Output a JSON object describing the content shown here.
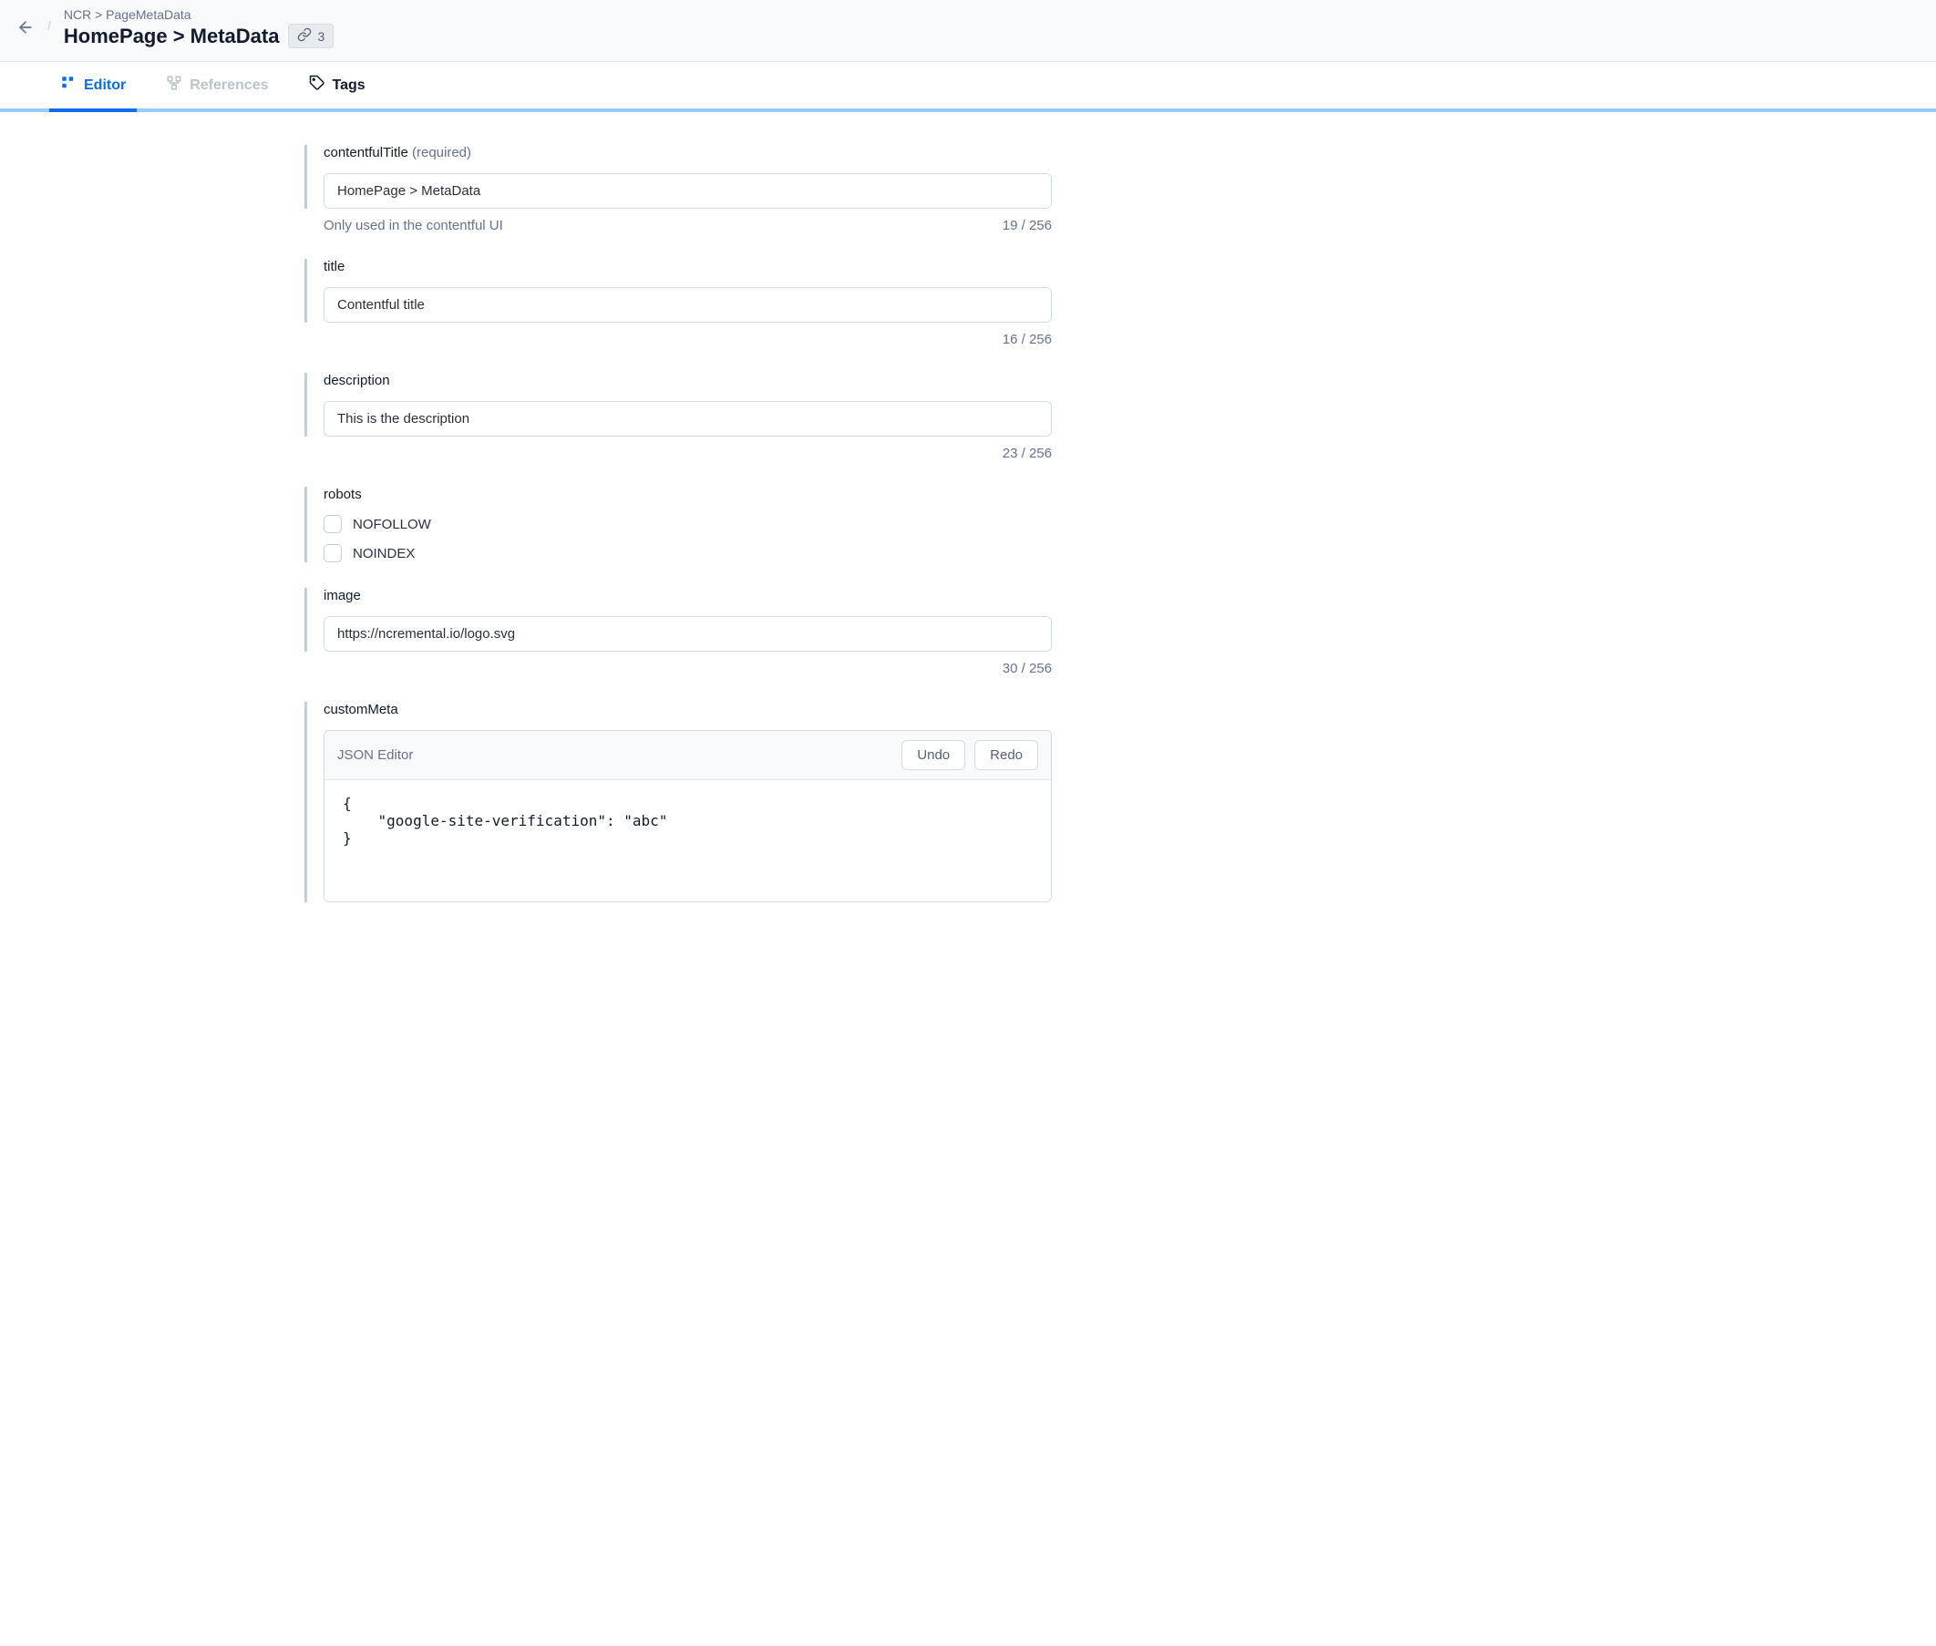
{
  "header": {
    "breadcrumb": "NCR > PageMetaData",
    "title": "HomePage > MetaData",
    "link_count": "3"
  },
  "tabs": {
    "editor": "Editor",
    "references": "References",
    "tags": "Tags"
  },
  "fields": {
    "contentfulTitle": {
      "label": "contentfulTitle",
      "required_suffix": "(required)",
      "value": "HomePage > MetaData",
      "helper": "Only used in the contentful UI",
      "counter": "19 / 256"
    },
    "title": {
      "label": "title",
      "value": "Contentful title",
      "counter": "16 / 256"
    },
    "description": {
      "label": "description",
      "value": "This is the description",
      "counter": "23 / 256"
    },
    "robots": {
      "label": "robots",
      "options": [
        "NOFOLLOW",
        "NOINDEX"
      ]
    },
    "image": {
      "label": "image",
      "value": "https://ncremental.io/logo.svg",
      "counter": "30 / 256"
    },
    "customMeta": {
      "label": "customMeta",
      "editor_title": "JSON Editor",
      "undo": "Undo",
      "redo": "Redo",
      "body": "{\n    \"google-site-verification\": \"abc\"\n}"
    }
  }
}
